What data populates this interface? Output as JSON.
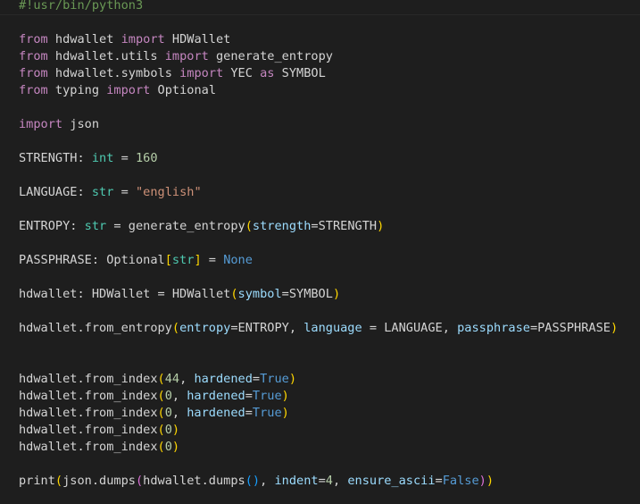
{
  "editor": {
    "language": "python",
    "colors": {
      "background": "#1e1e1e",
      "keyword": "#c586c0",
      "type": "#4ec9b0",
      "string": "#ce9178",
      "number": "#b5cea8",
      "parameter": "#9cdcfe",
      "comment": "#6a9955",
      "constant": "#569cd6",
      "bracket1": "#ffd700",
      "bracket2": "#da70d6",
      "bracket3": "#179fff",
      "text": "#d4d4d4"
    },
    "lines": [
      [
        [
          "c",
          "#!usr/bin/python3"
        ]
      ],
      [],
      [
        [
          "k",
          "from"
        ],
        [
          "d",
          " hdwallet "
        ],
        [
          "k",
          "import"
        ],
        [
          "d",
          " HDWallet"
        ]
      ],
      [
        [
          "k",
          "from"
        ],
        [
          "d",
          " hdwallet.utils "
        ],
        [
          "k",
          "import"
        ],
        [
          "d",
          " generate_entropy"
        ]
      ],
      [
        [
          "k",
          "from"
        ],
        [
          "d",
          " hdwallet.symbols "
        ],
        [
          "k",
          "import"
        ],
        [
          "d",
          " YEC "
        ],
        [
          "k",
          "as"
        ],
        [
          "d",
          " SYMBOL"
        ]
      ],
      [
        [
          "k",
          "from"
        ],
        [
          "d",
          " typing "
        ],
        [
          "k",
          "import"
        ],
        [
          "d",
          " Optional"
        ]
      ],
      [],
      [
        [
          "k",
          "import"
        ],
        [
          "d",
          " json"
        ]
      ],
      [],
      [
        [
          "d",
          "STRENGTH: "
        ],
        [
          "t",
          "int"
        ],
        [
          "d",
          " = "
        ],
        [
          "n",
          "160"
        ]
      ],
      [],
      [
        [
          "d",
          "LANGUAGE: "
        ],
        [
          "t",
          "str"
        ],
        [
          "d",
          " = "
        ],
        [
          "s",
          "\"english\""
        ]
      ],
      [],
      [
        [
          "d",
          "ENTROPY: "
        ],
        [
          "t",
          "str"
        ],
        [
          "d",
          " = generate_entropy"
        ],
        [
          "b1",
          "("
        ],
        [
          "p",
          "strength"
        ],
        [
          "d",
          "=STRENGTH"
        ],
        [
          "b1",
          ")"
        ]
      ],
      [],
      [
        [
          "d",
          "PASSPHRASE: Optional"
        ],
        [
          "b1",
          "["
        ],
        [
          "t",
          "str"
        ],
        [
          "b1",
          "]"
        ],
        [
          "d",
          " = "
        ],
        [
          "cn",
          "None"
        ]
      ],
      [],
      [
        [
          "d",
          "hdwallet: HDWallet = HDWallet"
        ],
        [
          "b1",
          "("
        ],
        [
          "p",
          "symbol"
        ],
        [
          "d",
          "=SYMBOL"
        ],
        [
          "b1",
          ")"
        ]
      ],
      [],
      [
        [
          "d",
          "hdwallet.from_entropy"
        ],
        [
          "b1",
          "("
        ],
        [
          "p",
          "entropy"
        ],
        [
          "d",
          "=ENTROPY, "
        ],
        [
          "p",
          "language"
        ],
        [
          "d",
          " = LANGUAGE, "
        ],
        [
          "p",
          "passphrase"
        ],
        [
          "d",
          "=PASSPHRASE"
        ],
        [
          "b1",
          ")"
        ]
      ],
      [],
      [],
      [
        [
          "d",
          "hdwallet.from_index"
        ],
        [
          "b1",
          "("
        ],
        [
          "n",
          "44"
        ],
        [
          "d",
          ", "
        ],
        [
          "p",
          "hardened"
        ],
        [
          "d",
          "="
        ],
        [
          "cn",
          "True"
        ],
        [
          "b1",
          ")"
        ]
      ],
      [
        [
          "d",
          "hdwallet.from_index"
        ],
        [
          "b1",
          "("
        ],
        [
          "n",
          "0"
        ],
        [
          "d",
          ", "
        ],
        [
          "p",
          "hardened"
        ],
        [
          "d",
          "="
        ],
        [
          "cn",
          "True"
        ],
        [
          "b1",
          ")"
        ]
      ],
      [
        [
          "d",
          "hdwallet.from_index"
        ],
        [
          "b1",
          "("
        ],
        [
          "n",
          "0"
        ],
        [
          "d",
          ", "
        ],
        [
          "p",
          "hardened"
        ],
        [
          "d",
          "="
        ],
        [
          "cn",
          "True"
        ],
        [
          "b1",
          ")"
        ]
      ],
      [
        [
          "d",
          "hdwallet.from_index"
        ],
        [
          "b1",
          "("
        ],
        [
          "n",
          "0"
        ],
        [
          "b1",
          ")"
        ]
      ],
      [
        [
          "d",
          "hdwallet.from_index"
        ],
        [
          "b1",
          "("
        ],
        [
          "n",
          "0"
        ],
        [
          "b1",
          ")"
        ]
      ],
      [],
      [
        [
          "d",
          "print"
        ],
        [
          "b1",
          "("
        ],
        [
          "d",
          "json.dumps"
        ],
        [
          "b2",
          "("
        ],
        [
          "d",
          "hdwallet.dumps"
        ],
        [
          "b3",
          "()"
        ],
        [
          "d",
          ", "
        ],
        [
          "p",
          "indent"
        ],
        [
          "d",
          "="
        ],
        [
          "n",
          "4"
        ],
        [
          "d",
          ", "
        ],
        [
          "p",
          "ensure_ascii"
        ],
        [
          "d",
          "="
        ],
        [
          "cn",
          "False"
        ],
        [
          "b2",
          ")"
        ],
        [
          "b1",
          ")"
        ]
      ]
    ]
  }
}
